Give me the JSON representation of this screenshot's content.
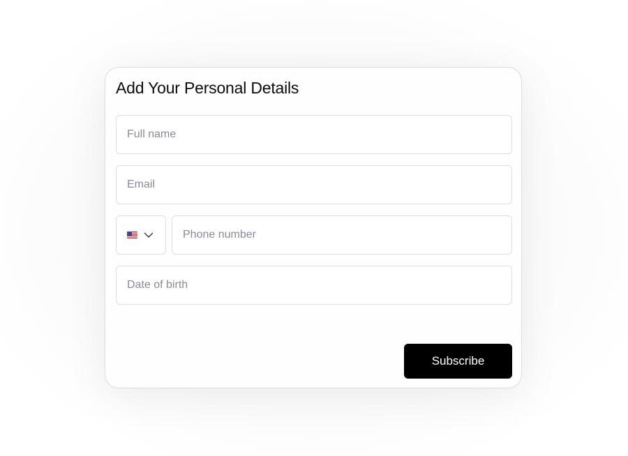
{
  "form": {
    "title": "Add Your Personal Details",
    "full_name": {
      "placeholder": "Full name",
      "value": ""
    },
    "email": {
      "placeholder": "Email",
      "value": ""
    },
    "country": {
      "selected": "US",
      "flag_icon": "us-flag-icon",
      "dropdown_icon": "chevron-down-icon"
    },
    "phone": {
      "placeholder": "Phone number",
      "value": ""
    },
    "dob": {
      "placeholder": "Date of birth",
      "value": ""
    },
    "submit_label": "Subscribe"
  },
  "colors": {
    "button_bg": "#000000",
    "button_text": "#ffffff",
    "border": "#dfdfe3",
    "placeholder": "#8a8a96"
  }
}
